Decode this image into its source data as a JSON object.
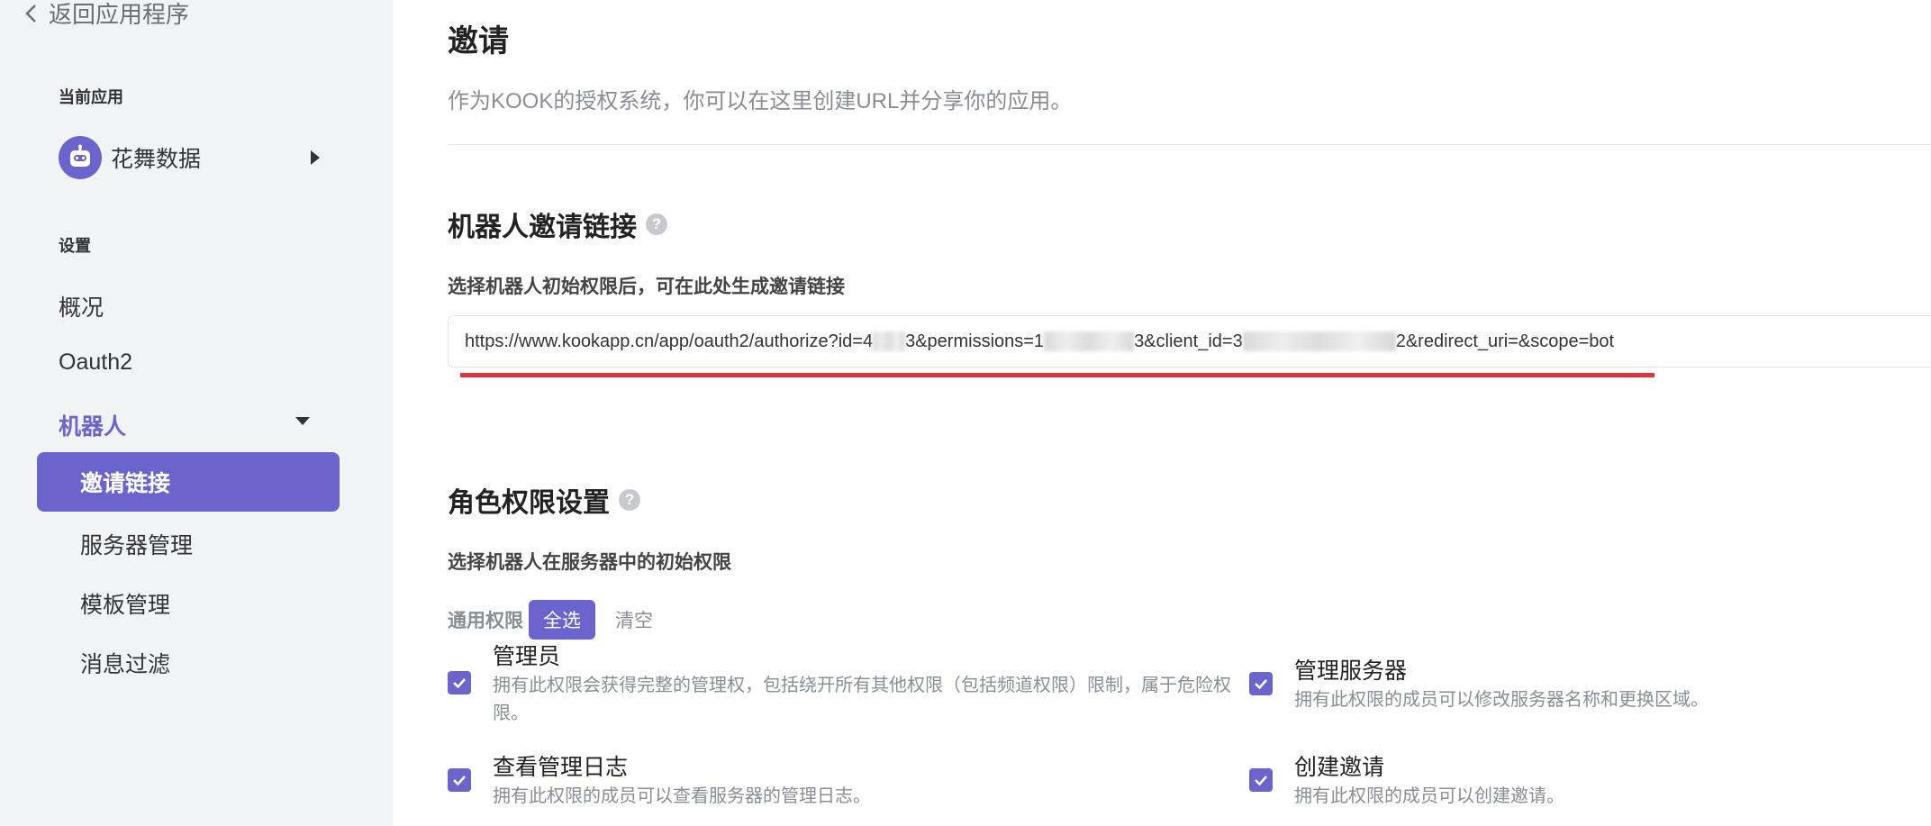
{
  "sidebar": {
    "back_label": "返回应用程序",
    "current_app_label": "当前应用",
    "app_name": "花舞数据",
    "settings_label": "设置",
    "nav": {
      "overview": "概况",
      "oauth2": "Oauth2",
      "bot": "机器人"
    },
    "bot_sub": {
      "invite": "邀请链接",
      "servers": "服务器管理",
      "templates": "模板管理",
      "message_filter": "消息过滤"
    }
  },
  "main": {
    "title": "邀请",
    "description": "作为KOOK的授权系统，你可以在这里创建URL并分享你的应用。",
    "bot_invite": {
      "heading": "机器人邀请链接",
      "help": "?",
      "subheading": "选择机器人初始权限后，可在此处生成邀请链接",
      "url": {
        "part1": "https://www.kookapp.cn/app/oauth2/authorize?id=4",
        "part2": "3&permissions=1",
        "part3": "3&client_id=3",
        "part4": "2&redirect_uri=&scope=bot"
      }
    },
    "role_perms": {
      "heading": "角色权限设置",
      "help": "?",
      "subheading": "选择机器人在服务器中的初始权限",
      "group_label": "通用权限",
      "select_all": "全选",
      "clear": "清空",
      "items": [
        {
          "title": "管理员",
          "desc": "拥有此权限会获得完整的管理权，包括绕开所有其他权限（包括频道权限）限制，属于危险权限。",
          "checked": true
        },
        {
          "title": "管理服务器",
          "desc": "拥有此权限的成员可以修改服务器名称和更换区域。",
          "checked": true
        },
        {
          "title": "查看管理日志",
          "desc": "拥有此权限的成员可以查看服务器的管理日志。",
          "checked": true
        },
        {
          "title": "创建邀请",
          "desc": "拥有此权限的成员可以创建邀请。",
          "checked": true
        }
      ]
    }
  },
  "colors": {
    "accent": "#6a64cc",
    "sidebar_bg": "#f2f3f5",
    "highlight_line": "#e0333a"
  }
}
